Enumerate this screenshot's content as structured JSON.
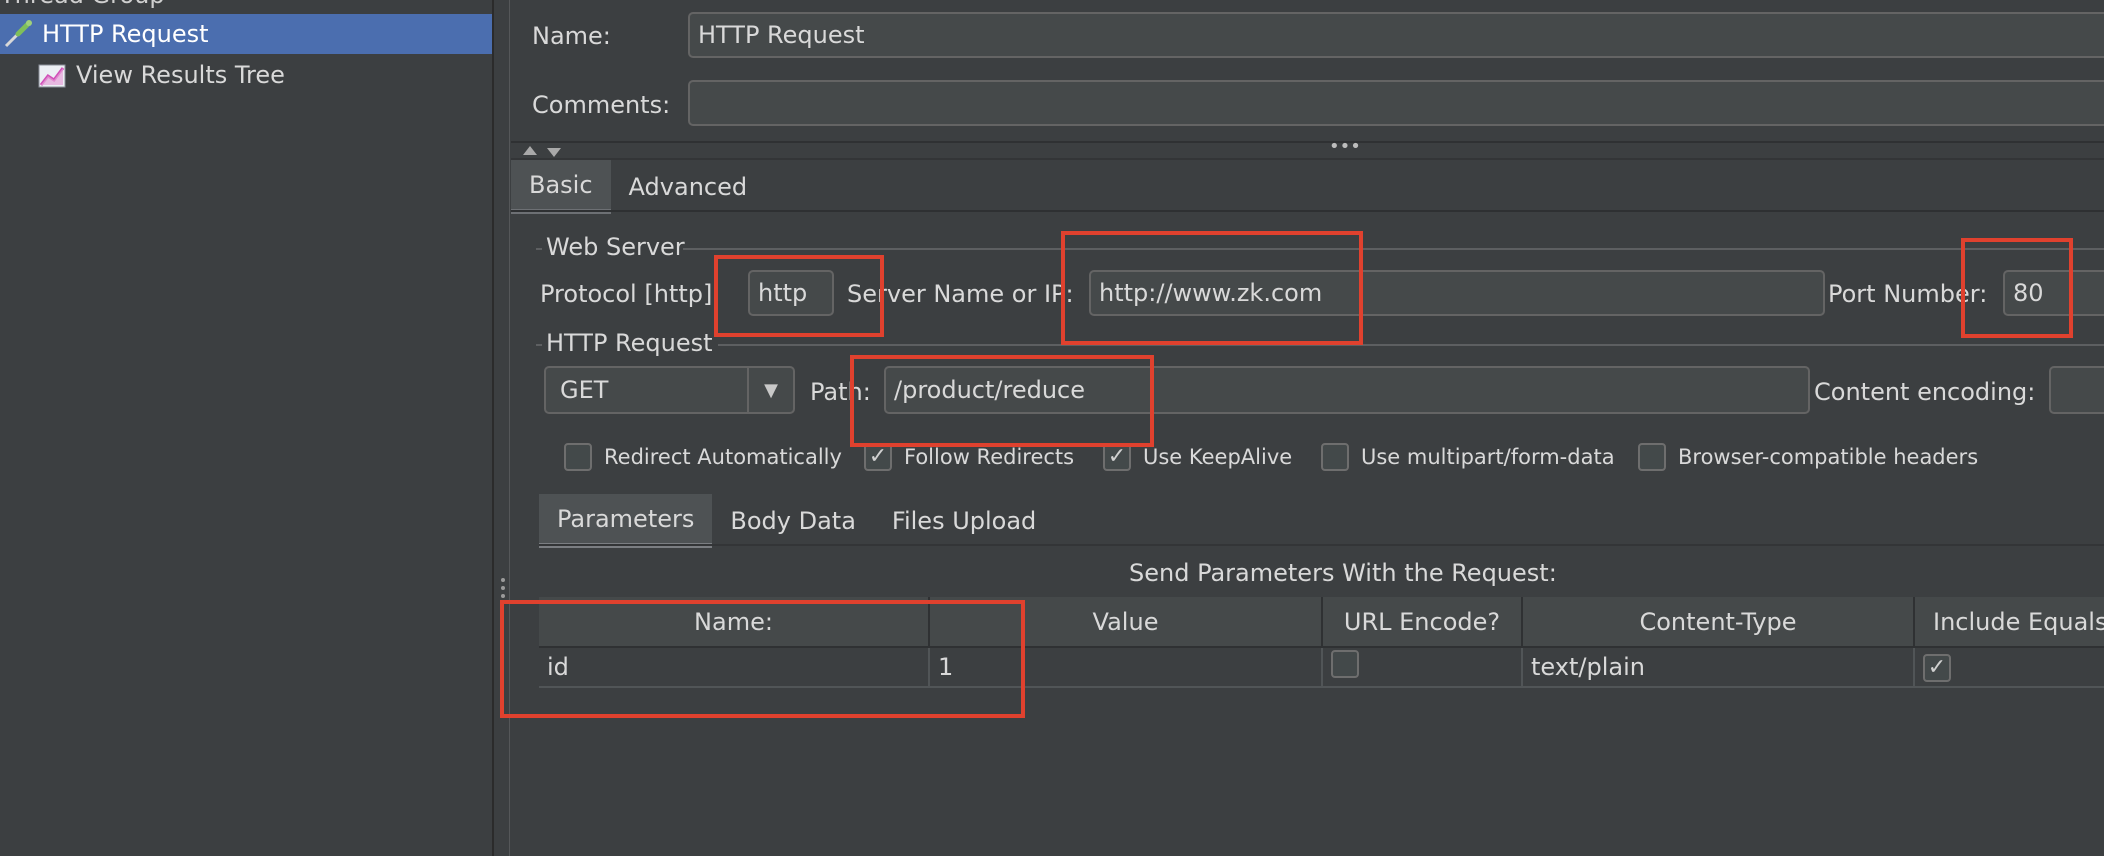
{
  "tree": {
    "partial_item": "Thread Group",
    "selected_item": "HTTP Request",
    "child_item": "View Results Tree"
  },
  "form": {
    "name_label": "Name:",
    "name_value": "HTTP Request",
    "comments_label": "Comments:",
    "comments_value": ""
  },
  "main_tabs": [
    {
      "label": "Basic",
      "active": true
    },
    {
      "label": "Advanced",
      "active": false
    }
  ],
  "web_server": {
    "title": "Web Server",
    "protocol_label": "Protocol [http]:",
    "protocol_value": "http",
    "server_label": "Server Name or IP:",
    "server_value": "http://www.zk.com",
    "port_label": "Port Number:",
    "port_value": "80"
  },
  "http_request": {
    "title": "HTTP Request",
    "method": "GET",
    "path_label": "Path:",
    "path_value": "/product/reduce",
    "encoding_label": "Content encoding:",
    "encoding_value": ""
  },
  "options": [
    {
      "label": "Redirect Automatically",
      "checked": false
    },
    {
      "label": "Follow Redirects",
      "checked": true
    },
    {
      "label": "Use KeepAlive",
      "checked": true
    },
    {
      "label": "Use multipart/form-data",
      "checked": false
    },
    {
      "label": "Browser-compatible headers",
      "checked": false
    }
  ],
  "sub_tabs": [
    {
      "label": "Parameters",
      "active": true
    },
    {
      "label": "Body Data",
      "active": false
    },
    {
      "label": "Files Upload",
      "active": false
    }
  ],
  "params": {
    "caption": "Send Parameters With the Request:",
    "columns": [
      "Name:",
      "Value",
      "URL Encode?",
      "Content-Type",
      "Include Equals?"
    ],
    "rows": [
      {
        "name": "id",
        "value": "1",
        "url_encode": false,
        "content_type": "text/plain",
        "include_equals": true
      }
    ]
  },
  "glyphs": {
    "check": "✓",
    "dropdown": "▼",
    "more": "•••"
  },
  "colors": {
    "selection": "#4b6eaf",
    "highlight": "#e0412e",
    "background": "#3c3f41"
  }
}
